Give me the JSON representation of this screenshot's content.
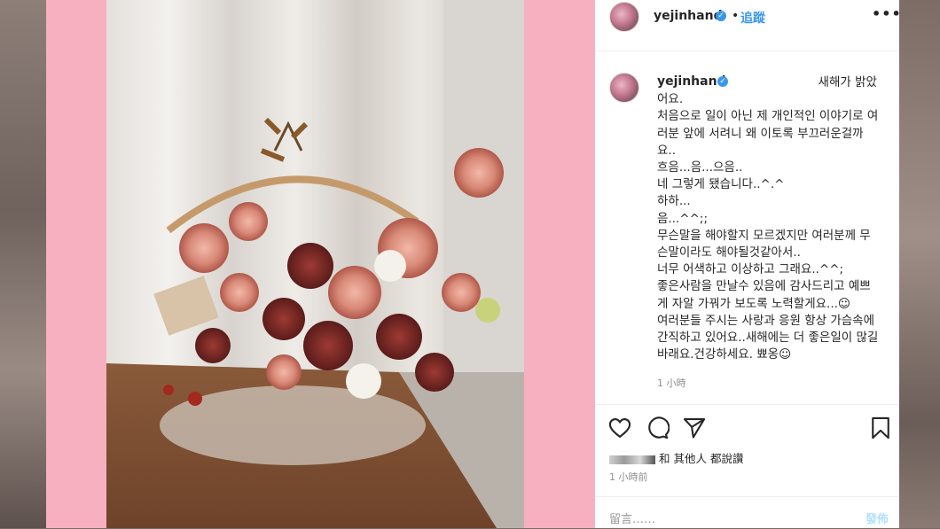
{
  "header": {
    "username": "yejinhand",
    "dot": "•",
    "follow_label": "追蹤",
    "more_label": "•••"
  },
  "caption": {
    "username": "yejinhand",
    "first_line": "새해가 밝았어요.",
    "body": "처음으로 일이 아닌 제 개인적인 이야기로 여러분 앞에 서려니 왜 이토록 부끄러운걸까요..\n흐음...음...으음..\n네 그렇게 됐습니다..^.^\n하하...\n음...^^;;\n무슨말을 해야할지 모르겠지만 여러분께 무슨말이라도 해야될것같아서..\n너무 어색하고 이상하고 그래요..^^;\n좋은사람을 만날수 있음에 감사드리고 예쁘게 자알 가꿔가 보도록 노력할게요...☺\n여러분들 주시는 사랑과 응원 항상 가슴속에 간직하고 있어요..새해에는 더 좋은일이 많길 바래요.건강하세요. 뾰옹☺",
    "time": "1 小時"
  },
  "actions": {
    "like_icon": "heart-icon",
    "comment_icon": "comment-icon",
    "share_icon": "share-icon",
    "save_icon": "bookmark-icon"
  },
  "likes": {
    "text": "和 其他人 都說讚"
  },
  "post_time": "1 小時前",
  "comment_box": {
    "placeholder": "留言……",
    "post_label": "發佈"
  },
  "colors": {
    "pink_frame": "#f7b0c0",
    "accent_blue": "#3897f0",
    "post_disabled": "#b2dffc"
  }
}
